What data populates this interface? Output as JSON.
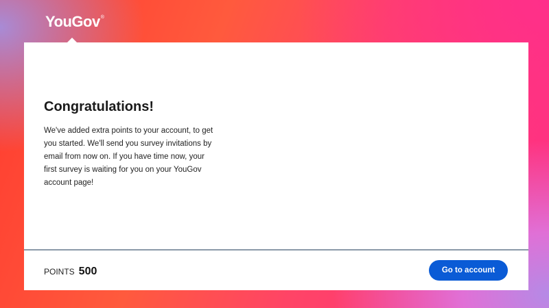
{
  "brand": {
    "name": "YouGov",
    "mark": "®"
  },
  "dialog": {
    "title": "Congratulations!",
    "message": "We've added extra points to your account, to get you started. We'll send you survey invitations by email from now on. If you have time now, your first survey is waiting for you on your YouGov account page!"
  },
  "footer": {
    "points_label": "POINTS",
    "points_value": "500",
    "cta_label": "Go to account"
  },
  "colors": {
    "accent": "#0a5bd6",
    "background_warm": "#ff4a3a",
    "background_pink": "#ff2d86"
  }
}
